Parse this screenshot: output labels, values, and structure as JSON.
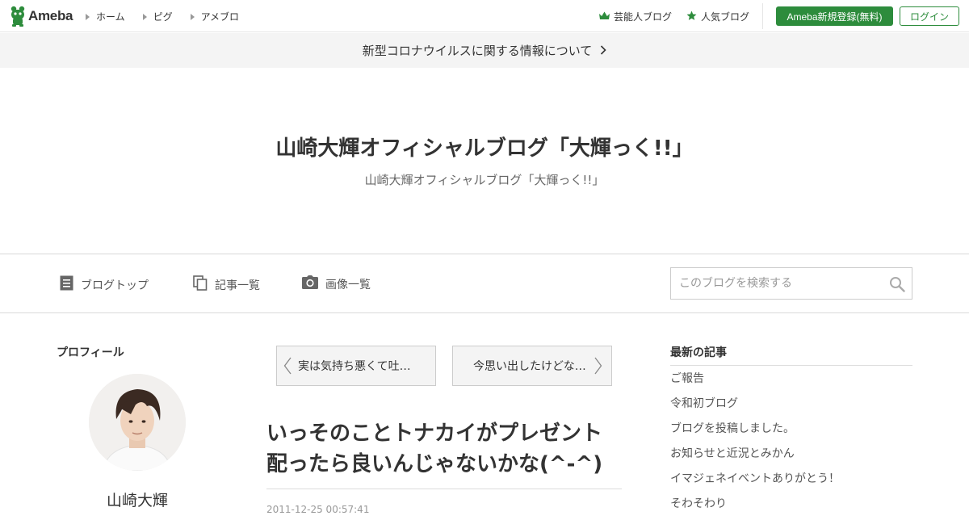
{
  "header": {
    "logo_text": "Ameba",
    "nav": [
      {
        "label": "ホーム"
      },
      {
        "label": "ピグ"
      },
      {
        "label": "アメブロ"
      }
    ],
    "celebrity_label": "芸能人ブログ",
    "popular_label": "人気ブログ",
    "register_label": "Ameba新規登録(無料)",
    "login_label": "ログイン",
    "accent": "#2d8c3c"
  },
  "notice": {
    "text": "新型コロナウイルスに関する情報について"
  },
  "blog": {
    "title": "山崎大輝オフィシャルブログ「大輝っく!!」",
    "description": "山崎大輝オフィシャルブログ「大輝っく!!」"
  },
  "blognav": {
    "items": [
      {
        "label": "ブログトップ",
        "icon": "document-icon"
      },
      {
        "label": "記事一覧",
        "icon": "copy-icon"
      },
      {
        "label": "画像一覧",
        "icon": "camera-icon"
      }
    ],
    "search_placeholder": "このブログを検索する"
  },
  "profile": {
    "heading": "プロフィール",
    "name": "山崎大輝"
  },
  "article": {
    "prev_title": "実は気持ち悪くて吐…",
    "next_title": "今思い出したけどな…",
    "title": "いっそのことトナカイがプレゼント配ったら良いんじゃないかな(^-^)",
    "date": "2011-12-25 00:57:41"
  },
  "latest": {
    "heading": "最新の記事",
    "items": [
      "ご報告",
      "令和初ブログ",
      "ブログを投稿しました。",
      "お知らせと近況とみかん",
      "イマジェネイベントありがとう！",
      "そわそわり"
    ]
  }
}
